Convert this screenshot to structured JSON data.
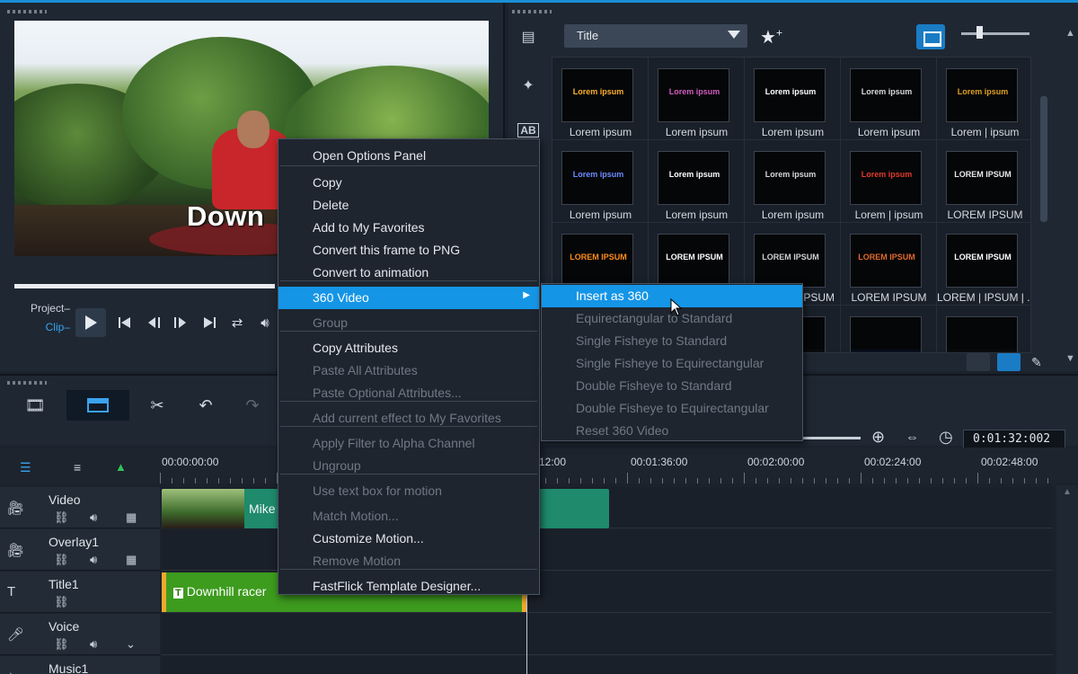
{
  "player": {
    "preview_text": "Down",
    "project_label": "Project–",
    "clip_label": "Clip–"
  },
  "library": {
    "category_dropdown": "Title",
    "thumbnails": [
      {
        "label": "Lorem ipsum",
        "art": "Lorem ipsum",
        "color": "#ffb02e"
      },
      {
        "label": "Lorem ipsum",
        "art": "Lorem ipsum",
        "color": "#d35bc0"
      },
      {
        "label": "Lorem ipsum",
        "art": "Lorem ipsum",
        "color": "#ffffff"
      },
      {
        "label": "Lorem ipsum",
        "art": "Lorem ipsum",
        "color": "#d9d9d9"
      },
      {
        "label": "Lorem | ipsum",
        "art": "Lorem ipsum",
        "color": "#e0a020"
      },
      {
        "label": "Lorem ipsum",
        "art": "Lorem ipsum",
        "color": "#6d8bff"
      },
      {
        "label": "Lorem ipsum",
        "art": "Lorem ipsum",
        "color": "#ffffff"
      },
      {
        "label": "Lorem ipsum",
        "art": "Lorem ipsum",
        "color": "#d9d9d9"
      },
      {
        "label": "Lorem | ipsum",
        "art": "Lorem ipsum",
        "color": "#e23b2c"
      },
      {
        "label": "LOREM IPSUM",
        "art": "LOREM IPSUM",
        "color": "#e8e8e8"
      },
      {
        "label": "",
        "art": "LOREM IPSUM",
        "color": "#ff8c1a"
      },
      {
        "label": "",
        "art": "LOREM IPSUM",
        "color": "#ffffff"
      },
      {
        "label": "",
        "art": "LOREM IPSUM",
        "color": "#cfcfcf"
      },
      {
        "label": "LOREM IPSUM",
        "art": "LOREM IPSUM",
        "color": "#e06a2a"
      },
      {
        "label": "LOREM | IPSUM | ...",
        "art": "LOREM IPSUM",
        "color": "#ffffff"
      },
      {
        "label": "",
        "art": "",
        "color": "#333"
      },
      {
        "label": "",
        "art": "",
        "color": "#333"
      },
      {
        "label": "",
        "art": "",
        "color": "#333"
      },
      {
        "label": "",
        "art": "",
        "color": "#1b4fb0"
      },
      {
        "label": "",
        "art": "",
        "color": "#333"
      }
    ],
    "partial_label_3": "IPSUM"
  },
  "timeline": {
    "timecode": "0:01:32:002",
    "ruler": [
      "00:00:00:00",
      "12:00",
      "00:01:36:00",
      "00:02:00:00",
      "00:02:24:00",
      "00:02:48:00"
    ],
    "tracks": [
      {
        "name": "Video"
      },
      {
        "name": "Overlay1"
      },
      {
        "name": "Title1"
      },
      {
        "name": "Voice"
      },
      {
        "name": "Music1"
      }
    ],
    "video_clip": "Mike",
    "title_clip": "Downhill racer"
  },
  "context_menu": {
    "items": [
      {
        "label": "Open Options Panel",
        "enabled": true
      },
      {
        "label": "Copy",
        "enabled": true
      },
      {
        "label": "Delete",
        "enabled": true
      },
      {
        "label": "Add to My Favorites",
        "enabled": true
      },
      {
        "label": "Convert this frame to PNG",
        "enabled": true
      },
      {
        "label": "Convert to animation",
        "enabled": true
      },
      {
        "label": "360 Video",
        "enabled": true
      },
      {
        "label": "Group",
        "enabled": false
      },
      {
        "label": "Copy Attributes",
        "enabled": true
      },
      {
        "label": "Paste All Attributes",
        "enabled": false
      },
      {
        "label": "Paste Optional Attributes...",
        "enabled": false
      },
      {
        "label": "Add current effect to My Favorites",
        "enabled": false
      },
      {
        "label": "Apply Filter to Alpha Channel",
        "enabled": false
      },
      {
        "label": "Ungroup",
        "enabled": false
      },
      {
        "label": "Use text box for motion",
        "enabled": false
      },
      {
        "label": "Match Motion...",
        "enabled": false
      },
      {
        "label": "Customize Motion...",
        "enabled": true
      },
      {
        "label": "Remove Motion",
        "enabled": false
      },
      {
        "label": "FastFlick Template Designer...",
        "enabled": true
      }
    ]
  },
  "submenu_360": {
    "items": [
      {
        "label": "Insert as 360",
        "enabled": true
      },
      {
        "label": "Equirectangular to Standard",
        "enabled": false
      },
      {
        "label": "Single Fisheye to Standard",
        "enabled": false
      },
      {
        "label": "Single Fisheye to Equirectangular",
        "enabled": false
      },
      {
        "label": "Double Fisheye to Standard",
        "enabled": false
      },
      {
        "label": "Double Fisheye to Equirectangular",
        "enabled": false
      },
      {
        "label": "Reset 360 Video",
        "enabled": false
      }
    ]
  },
  "colors": {
    "accent": "#1595e6",
    "video_clip": "#1f8a6c",
    "title_clip": "#3d9b1e"
  }
}
